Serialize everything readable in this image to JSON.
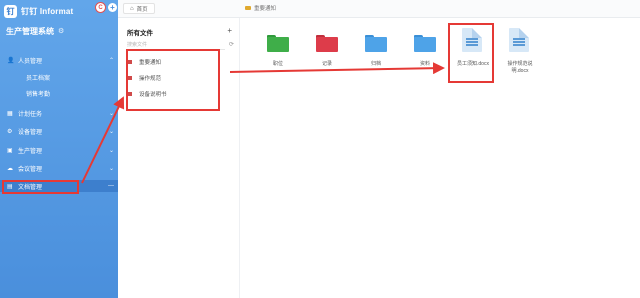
{
  "sidebar": {
    "brand": "钉钉 Informat",
    "avatar_letter": "C",
    "add_symbol": "+",
    "system_name": "生产管理系统",
    "items": [
      {
        "label": "人员管理",
        "icon": "people-icon",
        "expanded": true
      },
      {
        "label": "员工档案",
        "sub": true
      },
      {
        "label": "销售考勤",
        "sub": true
      },
      {
        "label": "计划任务",
        "icon": "calendar-icon"
      },
      {
        "label": "设备管理",
        "icon": "device-icon"
      },
      {
        "label": "生产管理",
        "icon": "factory-icon"
      },
      {
        "label": "会议管理",
        "icon": "meeting-icon"
      },
      {
        "label": "文档管理",
        "icon": "document-icon",
        "active": true
      }
    ]
  },
  "topbar": {
    "home_tab": "首页",
    "breadcrumb": "重要通知"
  },
  "tree": {
    "title": "所有文件",
    "search_placeholder": "搜索文件",
    "items": [
      "重要通知",
      "操作规范",
      "设备说明书"
    ]
  },
  "files": {
    "folders": [
      {
        "name": "职位",
        "color": "#3fae49"
      },
      {
        "name": "记录",
        "color": "#dd3c4a"
      },
      {
        "name": "归档",
        "color": "#4ea3e8"
      },
      {
        "name": "资料",
        "color": "#4ea3e8"
      }
    ],
    "docs": [
      {
        "name": "员工须知.docx",
        "highlighted": true
      },
      {
        "name": "操作规范说明.docx",
        "highlighted": false
      }
    ]
  },
  "annotation_color": "#e53935"
}
